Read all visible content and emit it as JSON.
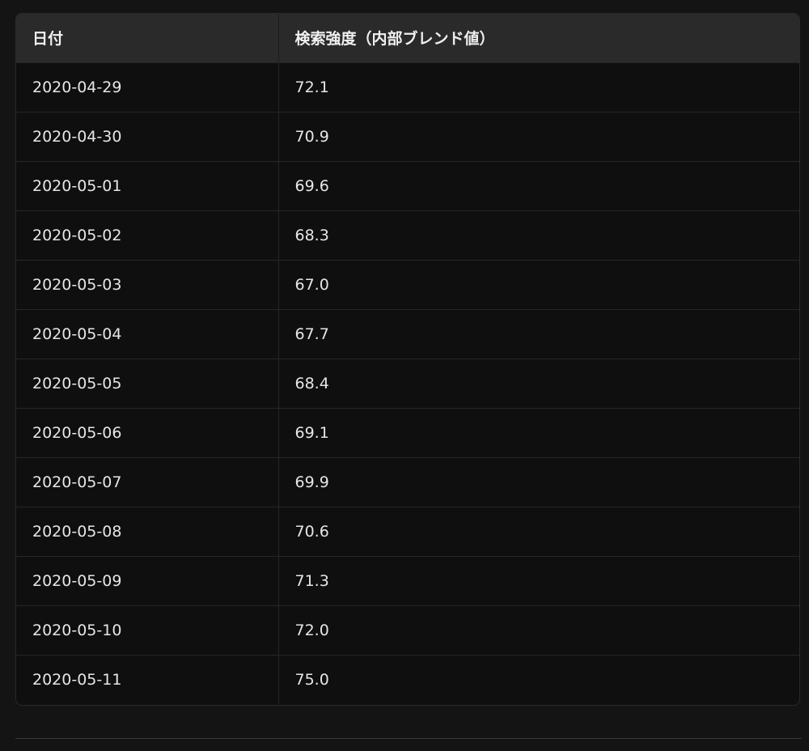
{
  "table": {
    "headers": [
      "日付",
      "検索強度（内部ブレンド値）"
    ],
    "rows": [
      [
        "2020-04-29",
        "72.1"
      ],
      [
        "2020-04-30",
        "70.9"
      ],
      [
        "2020-05-01",
        "69.6"
      ],
      [
        "2020-05-02",
        "68.3"
      ],
      [
        "2020-05-03",
        "67.0"
      ],
      [
        "2020-05-04",
        "67.7"
      ],
      [
        "2020-05-05",
        "68.4"
      ],
      [
        "2020-05-06",
        "69.1"
      ],
      [
        "2020-05-07",
        "69.9"
      ],
      [
        "2020-05-08",
        "70.6"
      ],
      [
        "2020-05-09",
        "71.3"
      ],
      [
        "2020-05-10",
        "72.0"
      ],
      [
        "2020-05-11",
        "75.0"
      ]
    ]
  },
  "colors": {
    "background": "#141414",
    "header_bg": "#2a2a2a",
    "table_bg": "#0f0f0f",
    "text": "#e6e6e6"
  }
}
